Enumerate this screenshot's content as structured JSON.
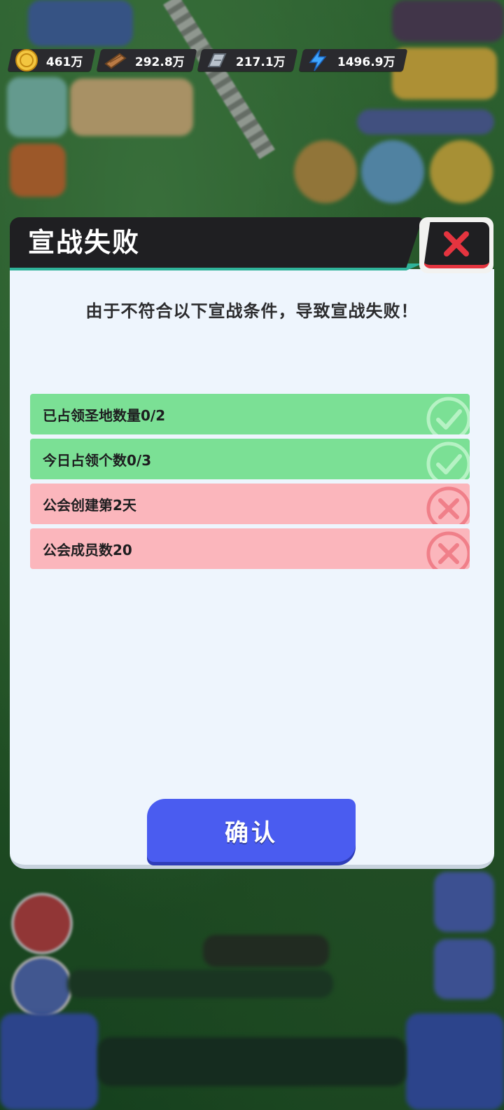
{
  "resources": [
    {
      "icon": "gold-coin-icon",
      "value": "461万"
    },
    {
      "icon": "wood-plank-icon",
      "value": "292.8万"
    },
    {
      "icon": "steel-ingot-icon",
      "value": "217.1万"
    },
    {
      "icon": "energy-bolt-icon",
      "value": "1496.9万"
    }
  ],
  "modal": {
    "title": "宣战失败",
    "subtitle": "由于不符合以下宣战条件，导致宣战失败！",
    "conditions": [
      {
        "label": "已占领圣地数量0/2",
        "status": "met"
      },
      {
        "label": "今日占领个数0/3",
        "status": "met"
      },
      {
        "label": "公会创建第2天",
        "status": "unmet"
      },
      {
        "label": "公会成员数20",
        "status": "unmet"
      }
    ],
    "confirm_label": "确认"
  },
  "colors": {
    "met": "#7be095",
    "unmet": "#fbb6bc",
    "confirm": "#4a5cf0",
    "header": "#1f1f22",
    "close_x": "#e5343f"
  }
}
